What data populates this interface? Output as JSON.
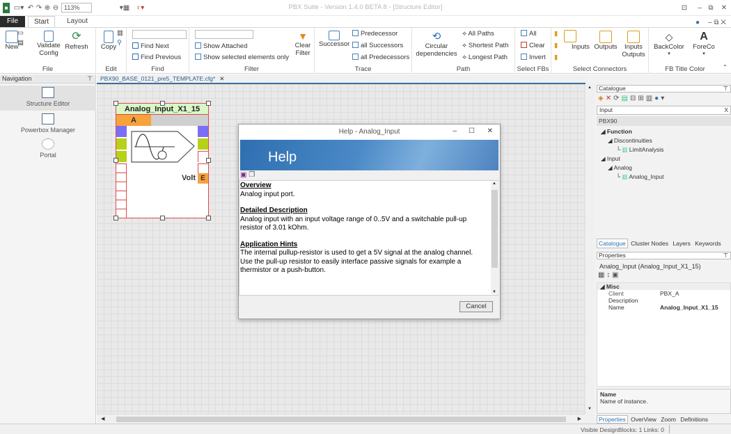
{
  "window": {
    "title": "PBX Suite - Version 1.4.0 BETA 8 - [Structure Editor]",
    "zoom": "113%"
  },
  "tabs": {
    "file": "File",
    "start": "Start",
    "layout": "Layout"
  },
  "ribbon": {
    "file_group": {
      "new": "New",
      "validate": "Validate",
      "config": "Config",
      "refresh": "Refresh",
      "label": "File"
    },
    "edit_group": {
      "copy": "Copy",
      "label": "Edit"
    },
    "find_group": {
      "find_next": "Find Next",
      "find_previous": "Find Previous",
      "label": "Find"
    },
    "filter_group": {
      "show_attached": "Show Attached",
      "show_selected": "Show selected elements only",
      "clear": "Clear",
      "filter": "Filter",
      "label": "Filter"
    },
    "trace_group": {
      "successor": "Successor",
      "predecessor": "Predecessor",
      "all_successors": "all Successors",
      "all_predecessors": "all Predecessors",
      "label": "Trace"
    },
    "path_group": {
      "circular": "Circular",
      "dependencies": "dependencies",
      "all_paths": "All Paths",
      "shortest_path": "Shortest Path",
      "longest_path": "Longest Path",
      "label": "Path"
    },
    "selectfbs_group": {
      "all": "All",
      "clear": "Clear",
      "invert": "Invert",
      "label": "Select FBs"
    },
    "connectors_group": {
      "inputs": "Inputs",
      "outputs": "Outputs",
      "inputs_outputs_1": "Inputs",
      "inputs_outputs_2": "Outputs",
      "label": "Select Connectors"
    },
    "title_color_group": {
      "backcolor": "BackColor",
      "forecolor": "ForeCo",
      "label": "FB Title Color"
    }
  },
  "navigation": {
    "header": "Navigation",
    "items": [
      {
        "label": "Structure Editor"
      },
      {
        "label": "Powerbox Manager"
      },
      {
        "label": "Portal"
      }
    ]
  },
  "document": {
    "tab_label": "PBX90_BASE_0121_pre5_TEMPLATE.cfg*"
  },
  "block": {
    "title": "Analog_Input_X1_15",
    "client_letter": "A",
    "output_label": "Volt",
    "output_letter": "E"
  },
  "help": {
    "title": "Help - Analog_Input",
    "banner": "Help",
    "sections": [
      {
        "heading": "Overview",
        "text": "Analog input port."
      },
      {
        "heading": "Detailed Description",
        "text": "Analog input with an input voltage range of 0..5V and a switchable pull-up resistor of 3.01 kOhm."
      },
      {
        "heading": "Application Hints",
        "text": "The internal pullup-resistor is used to get a 5V signal at the analog channel. Use the pull-up resistor to easily interface passive signals for example a thermistor or a push-button."
      }
    ],
    "cancel": "Cancel"
  },
  "catalogue": {
    "header": "Catalogue",
    "search_value": "Input",
    "root": "PBX90",
    "tree": [
      {
        "label": "Function",
        "level": 0
      },
      {
        "label": "Discontinuities",
        "level": 1
      },
      {
        "label": "LimitAnalysis",
        "level": 2
      },
      {
        "label": "Input",
        "level": 0
      },
      {
        "label": "Analog",
        "level": 1
      },
      {
        "label": "Analog_Input",
        "level": 2
      }
    ],
    "tabs": [
      "Catalogue",
      "Cluster Nodes",
      "Layers",
      "Keywords"
    ]
  },
  "properties": {
    "header": "Properties",
    "object": "Analog_Input (Analog_Input_X1_15)",
    "category": "Misc",
    "rows": [
      {
        "key": "Client",
        "value": "PBX_A"
      },
      {
        "key": "Description",
        "value": ""
      },
      {
        "key": "Name",
        "value": "Analog_Input_X1_15"
      }
    ],
    "desc_title": "Name",
    "desc_text": "Name of instance.",
    "tabs": [
      "Properties",
      "OverView",
      "Zoom",
      "Definitions"
    ]
  },
  "status": {
    "text": "Visible DesignBlocks: 1 Links: 0"
  }
}
